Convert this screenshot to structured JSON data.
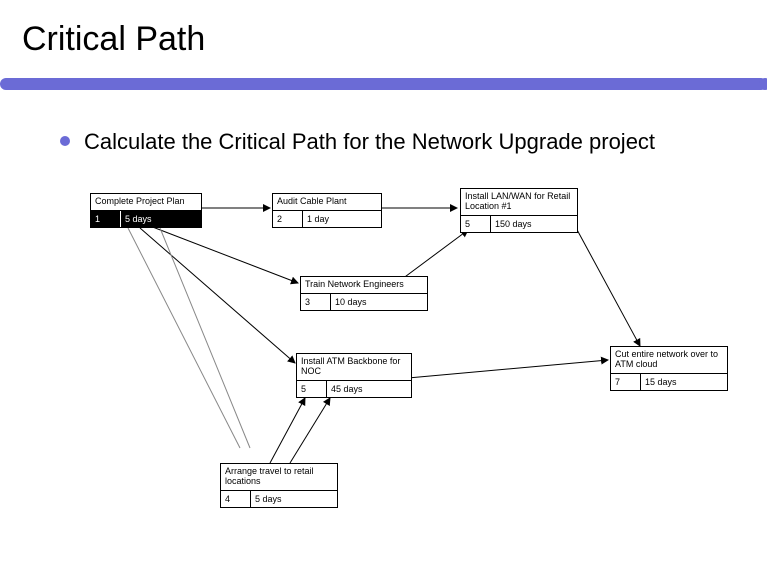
{
  "title": "Critical Path",
  "bullet_text": "Calculate the Critical Path for the Network Upgrade project",
  "nodes": {
    "n1": {
      "title": "Complete Project Plan",
      "id": "1",
      "duration": "5 days"
    },
    "n2": {
      "title": "Audit Cable Plant",
      "id": "2",
      "duration": "1 day"
    },
    "n5a": {
      "title": "Install LAN/WAN for Retail Location #1",
      "id": "5",
      "duration": "150 days"
    },
    "n3": {
      "title": "Train Network Engineers",
      "id": "3",
      "duration": "10 days"
    },
    "n5b": {
      "title": "Install ATM Backbone for NOC",
      "id": "5",
      "duration": "45 days"
    },
    "n7": {
      "title": "Cut entire network over to ATM cloud",
      "id": "7",
      "duration": "15 days"
    },
    "n4": {
      "title": "Arrange travel to retail locations",
      "id": "4",
      "duration": "5 days"
    }
  }
}
